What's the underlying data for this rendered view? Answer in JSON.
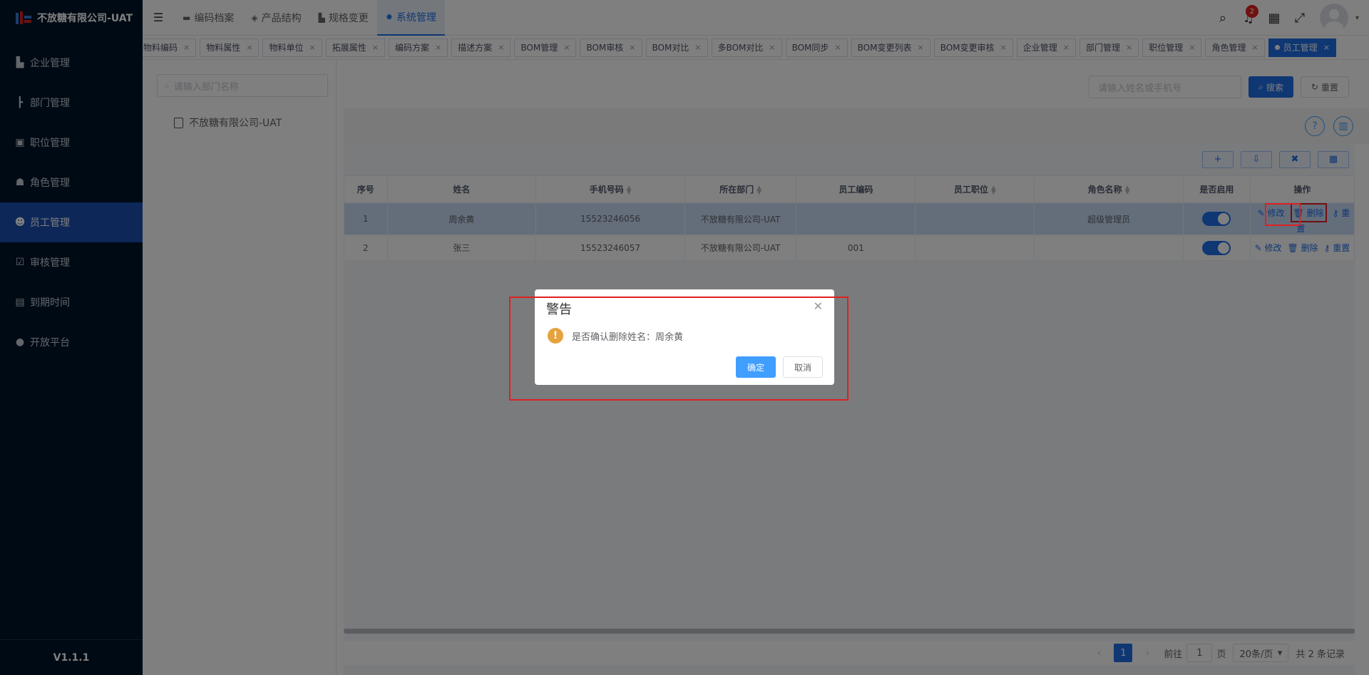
{
  "app": {
    "title": "不放糖有限公司-UAT",
    "version": "V1.1.1"
  },
  "sidebar": {
    "items": [
      {
        "label": "企业管理",
        "icon": "building-icon"
      },
      {
        "label": "部门管理",
        "icon": "tree-icon"
      },
      {
        "label": "职位管理",
        "icon": "id-card-icon"
      },
      {
        "label": "角色管理",
        "icon": "role-icon"
      },
      {
        "label": "员工管理",
        "icon": "user-icon",
        "active": true
      },
      {
        "label": "审核管理",
        "icon": "check-icon"
      },
      {
        "label": "到期时间",
        "icon": "calendar-icon"
      },
      {
        "label": "开放平台",
        "icon": "platform-icon"
      }
    ]
  },
  "topnav": {
    "tabs": [
      {
        "label": "编码档案"
      },
      {
        "label": "产品结构"
      },
      {
        "label": "规格变更"
      },
      {
        "label": "系统管理",
        "active": true
      }
    ],
    "notification_count": "2"
  },
  "tags": [
    "物料编码",
    "物料属性",
    "物料单位",
    "拓展属性",
    "编码方案",
    "描述方案",
    "BOM管理",
    "BOM审核",
    "BOM对比",
    "多BOM对比",
    "BOM同步",
    "BOM变更列表",
    "BOM变更审核",
    "企业管理",
    "部门管理",
    "职位管理",
    "角色管理",
    "员工管理"
  ],
  "dept": {
    "search_placeholder": "请输入部门名称",
    "root": "不放糖有限公司-UAT"
  },
  "search": {
    "placeholder": "请输入姓名或手机号",
    "search_label": "搜索",
    "reset_label": "重置"
  },
  "table": {
    "headers": [
      "序号",
      "姓名",
      "手机号码",
      "所在部门",
      "员工编码",
      "员工职位",
      "角色名称",
      "是否启用",
      "操作"
    ],
    "rows": [
      {
        "idx": "1",
        "name": "周余黄",
        "phone": "15523246056",
        "dept": "不放糖有限公司-UAT",
        "code": "",
        "position": "",
        "role": "超级管理员",
        "enabled": true
      },
      {
        "idx": "2",
        "name": "张三",
        "phone": "15523246057",
        "dept": "不放糖有限公司-UAT",
        "code": "001",
        "position": "",
        "role": "",
        "enabled": true
      }
    ],
    "ops": {
      "edit": "修改",
      "delete": "删除",
      "reset": "重置"
    }
  },
  "pager": {
    "current": "1",
    "goto_prefix": "前往",
    "goto_value": "1",
    "goto_suffix": "页",
    "page_size": "20条/页",
    "total": "共 2 条记录"
  },
  "dialog": {
    "title": "警告",
    "message": "是否确认删除姓名：周余黄",
    "ok": "确定",
    "cancel": "取消"
  },
  "colors": {
    "primary": "#1f6ee6",
    "sidebar": "#001529",
    "warning": "#e6a23c",
    "highlight": "#e02020"
  }
}
